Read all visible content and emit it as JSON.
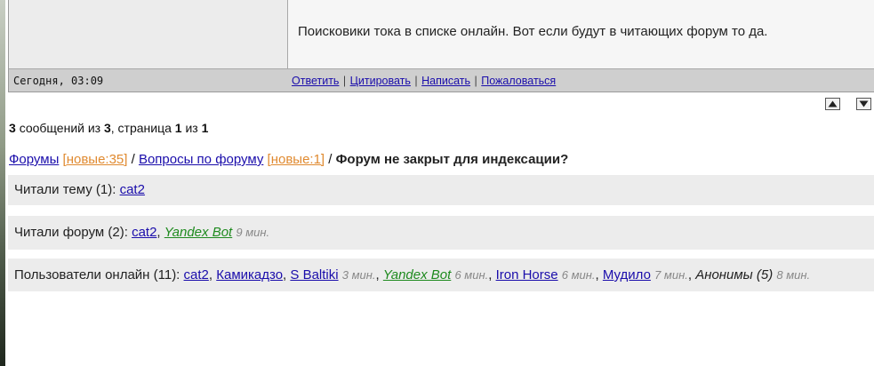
{
  "post": {
    "text": "Поисковики тока в списке онлайн. Вот если будут в читающих форум то да.",
    "date": "Сегодня, 03:09",
    "actions": [
      "Ответить",
      "Цитировать",
      "Написать",
      "Пожаловаться"
    ],
    "separator": "|"
  },
  "nav": {
    "up_icon": "arrow-up-icon",
    "down_icon": "arrow-down-icon"
  },
  "pagination": {
    "count": "3",
    "text1": "сообщений из",
    "total": "3",
    "text2": ", страница",
    "page": "1",
    "text3": "из",
    "pages": "1"
  },
  "breadcrumb": {
    "forums": "Форумы",
    "forums_new": "[новые:35]",
    "sep": "/",
    "section": "Вопросы по форуму",
    "section_new": "[новые:1]",
    "current": "Форум не закрыт для индексации?"
  },
  "readers_topic": {
    "label": "Читали тему (1):",
    "users": [
      "cat2"
    ]
  },
  "readers_forum": {
    "label": "Читали форум (2):",
    "user1": "cat2",
    "bot": "Yandex Bot",
    "bot_time": "9 мин."
  },
  "online": {
    "label": "Пользователи онлайн (11):",
    "u1": "cat2",
    "u2": "Камикадзо",
    "u3": "S Baltiki",
    "u3_time": "3 мин.",
    "bot": "Yandex Bot",
    "bot_time": "6 мин.",
    "u4": "Iron Horse",
    "u4_time": "6 мин.",
    "u5": "Мудило",
    "u5_time": "7 мин.",
    "anon": "Анонимы (5)",
    "anon_time": "8 мин."
  },
  "colors": {
    "link": "#1a0dab",
    "new_badge": "#e08a30",
    "bot_link": "#1e8a1e",
    "footer_bg": "#cfcfcf",
    "box_bg": "#ececec"
  }
}
